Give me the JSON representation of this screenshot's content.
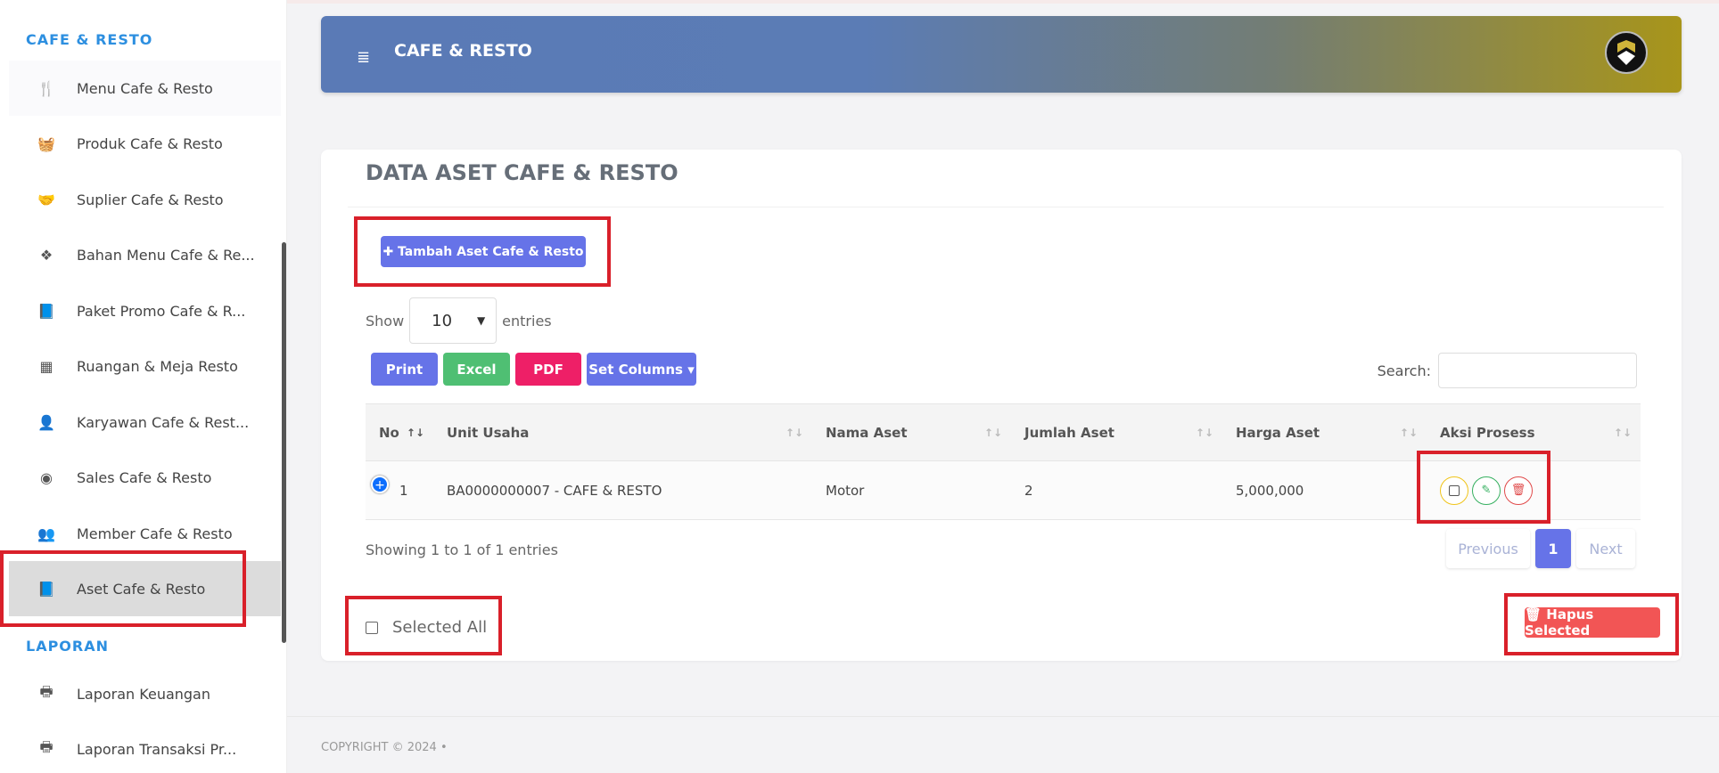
{
  "sidebar": {
    "section1": "CAFE & RESTO",
    "items": [
      {
        "label": "Menu Cafe & Resto",
        "icon": "utensils-icon",
        "glyph": "🍴"
      },
      {
        "label": "Produk Cafe & Resto",
        "icon": "basket-icon",
        "glyph": "🧺"
      },
      {
        "label": "Suplier Cafe & Resto",
        "icon": "handshake-icon",
        "glyph": "🤝"
      },
      {
        "label": "Bahan Menu Cafe & Re...",
        "icon": "cubes-icon",
        "glyph": "❖"
      },
      {
        "label": "Paket Promo Cafe & R...",
        "icon": "book-icon",
        "glyph": "📘"
      },
      {
        "label": "Ruangan & Meja Resto",
        "icon": "building-icon",
        "glyph": "▦"
      },
      {
        "label": "Karyawan Cafe & Rest...",
        "icon": "user-tie-icon",
        "glyph": "👤"
      },
      {
        "label": "Sales Cafe & Resto",
        "icon": "user-circle-icon",
        "glyph": "◉"
      },
      {
        "label": "Member Cafe & Resto",
        "icon": "users-icon",
        "glyph": "👥"
      },
      {
        "label": "Aset Cafe & Resto",
        "icon": "book-icon",
        "glyph": "📘"
      }
    ],
    "section2": "LAPORAN",
    "reports": [
      {
        "label": "Laporan Keuangan",
        "icon": "print-icon",
        "glyph": "🖶"
      },
      {
        "label": "Laporan Transaksi Pr...",
        "icon": "print-icon",
        "glyph": "🖶"
      }
    ]
  },
  "header": {
    "title": "CAFE & RESTO",
    "menu_glyph": "≣"
  },
  "card": {
    "title": "DATA ASET CAFE & RESTO",
    "add_button": "✚ Tambah Aset Cafe & Resto",
    "show_label": "Show",
    "entries_value": "10",
    "entries_label": "entries",
    "exports": {
      "print": "Print",
      "excel": "Excel",
      "pdf": "PDF",
      "columns": "Set Columns ▾"
    },
    "search_label": "Search:",
    "columns": [
      "No",
      "Unit Usaha",
      "Nama Aset",
      "Jumlah Aset",
      "Harga Aset",
      "Aksi Prosess"
    ],
    "rows": [
      {
        "no": "1",
        "unit": "BA0000000007 - CAFE & RESTO",
        "nama": "Motor",
        "jumlah": "2",
        "harga": "5,000,000"
      }
    ],
    "showing": "Showing 1 to 1 of 1 entries",
    "pager": {
      "prev": "Previous",
      "page": "1",
      "next": "Next"
    },
    "select_all": "Selected All",
    "delete_selected": "🗑 Hapus Selected"
  },
  "footer": {
    "copyright": "COPYRIGHT © 2024  •"
  },
  "colors": {
    "accent": "#6673e8",
    "excel": "#4fbf73",
    "pdf": "#ee1f67",
    "danger": "#f25555",
    "highlight": "#d9202a"
  }
}
